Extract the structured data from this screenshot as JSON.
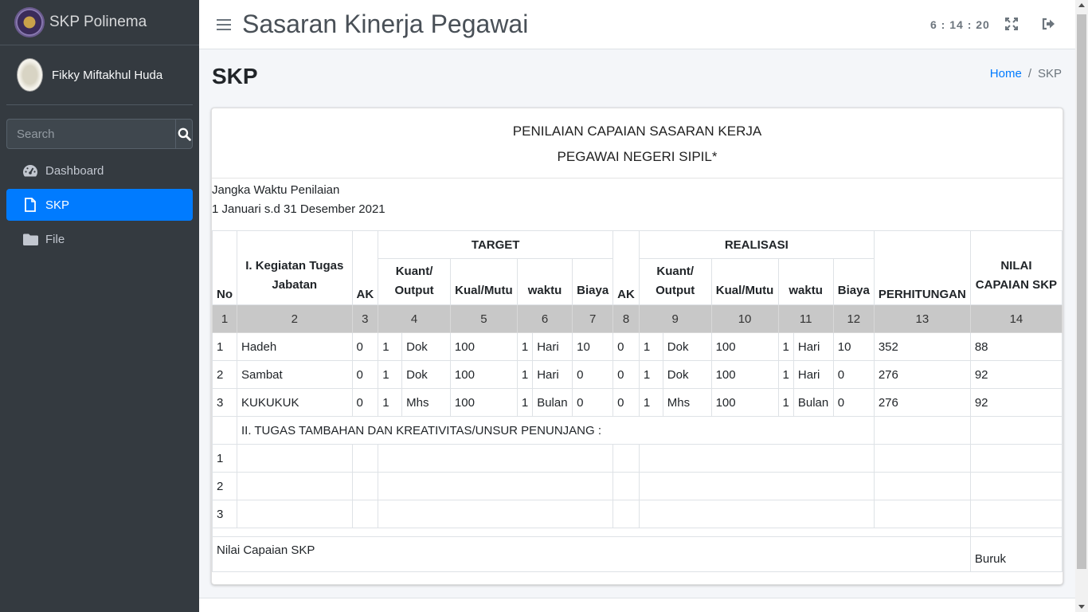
{
  "sidebar": {
    "brand": "SKP Polinema",
    "user_name": "Fikky Miftakhul Huda",
    "search_placeholder": "Search",
    "items": [
      {
        "label": "Dashboard",
        "icon": "dashboard-icon"
      },
      {
        "label": "SKP",
        "icon": "file-icon",
        "active": true
      },
      {
        "label": "File",
        "icon": "folder-icon"
      }
    ]
  },
  "header": {
    "title": "Sasaran Kinerja Pegawai",
    "clock": "6 : 14 : 20"
  },
  "page": {
    "title": "SKP",
    "breadcrumb": {
      "home": "Home",
      "sep": "/",
      "current": "SKP"
    }
  },
  "card": {
    "title_line1": "PENILAIAN CAPAIAN SASARAN KERJA",
    "title_line2": "PEGAWAI NEGERI SIPIL*",
    "period_label": "Jangka Waktu Penilaian",
    "period_value": "1 Januari s.d 31 Desember 2021"
  },
  "table": {
    "headers": {
      "no": "No",
      "kegiatan": "I. Kegiatan Tugas Jabatan",
      "ak": "AK",
      "target": "TARGET",
      "realisasi": "REALISASI",
      "kuant": "Kuant/ Output",
      "kual": "Kual/Mutu",
      "waktu": "waktu",
      "biaya": "Biaya",
      "perhitungan": "PERHITUNGAN",
      "nilai": "NILAI CAPAIAN SKP"
    },
    "numbers": [
      "1",
      "2",
      "3",
      "4",
      "5",
      "6",
      "7",
      "8",
      "9",
      "10",
      "11",
      "12",
      "13",
      "14"
    ],
    "rows": [
      {
        "no": "1",
        "kegiatan": "Hadeh",
        "ak": "0",
        "t_kuant": "1",
        "t_unit": "Dok",
        "t_kual": "100",
        "t_waktu": "1",
        "t_wunit": "Hari",
        "t_biaya": "10",
        "r_ak": "0",
        "r_kuant": "1",
        "r_unit": "Dok",
        "r_kual": "100",
        "r_waktu": "1",
        "r_wunit": "Hari",
        "r_biaya": "10",
        "perhitungan": "352",
        "nilai": "88"
      },
      {
        "no": "2",
        "kegiatan": "Sambat",
        "ak": "0",
        "t_kuant": "1",
        "t_unit": "Dok",
        "t_kual": "100",
        "t_waktu": "1",
        "t_wunit": "Hari",
        "t_biaya": "0",
        "r_ak": "0",
        "r_kuant": "1",
        "r_unit": "Dok",
        "r_kual": "100",
        "r_waktu": "1",
        "r_wunit": "Hari",
        "r_biaya": "0",
        "perhitungan": "276",
        "nilai": "92"
      },
      {
        "no": "3",
        "kegiatan": "KUKUKUK",
        "ak": "0",
        "t_kuant": "1",
        "t_unit": "Mhs",
        "t_kual": "100",
        "t_waktu": "1",
        "t_wunit": "Bulan",
        "t_biaya": "0",
        "r_ak": "0",
        "r_kuant": "1",
        "r_unit": "Mhs",
        "r_kual": "100",
        "r_waktu": "1",
        "r_wunit": "Bulan",
        "r_biaya": "0",
        "perhitungan": "276",
        "nilai": "92"
      }
    ],
    "section2_title": "II. TUGAS TAMBAHAN DAN KREATIVITAS/UNSUR PENUNJANG :",
    "section2_numbers": [
      "1",
      "2",
      "3"
    ],
    "summary_label": "Nilai Capaian SKP",
    "summary_value": "Buruk"
  }
}
